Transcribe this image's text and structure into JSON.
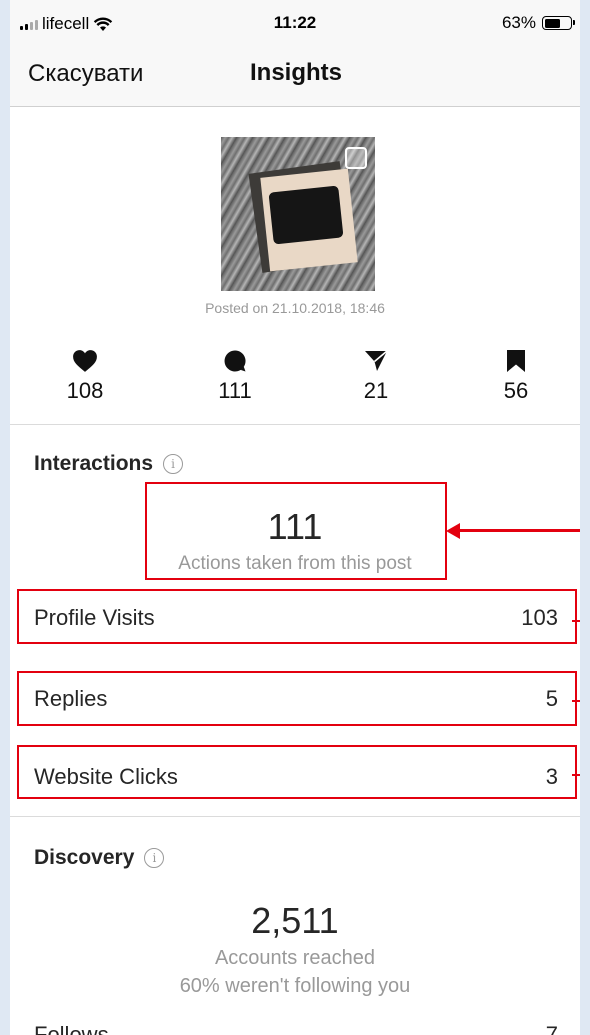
{
  "status_bar": {
    "carrier": "lifecell",
    "time": "11:22",
    "battery": "63%",
    "battery_level": 0.63
  },
  "nav": {
    "cancel_label": "Скасувати",
    "title": "Insights"
  },
  "post": {
    "posted": "Posted on 21.10.2018, 18:46"
  },
  "stats": [
    {
      "icon": "heart-icon",
      "value": "108"
    },
    {
      "icon": "comment-icon",
      "value": "111"
    },
    {
      "icon": "send-icon",
      "value": "21"
    },
    {
      "icon": "bookmark-icon",
      "value": "56"
    }
  ],
  "interactions": {
    "title": "Interactions",
    "total": "111",
    "total_label": "Actions taken from this post",
    "rows": [
      {
        "label": "Profile Visits",
        "value": "103"
      },
      {
        "label": "Replies",
        "value": "5"
      },
      {
        "label": "Website Clicks",
        "value": "3"
      }
    ]
  },
  "discovery": {
    "title": "Discovery",
    "total": "2,511",
    "total_label": "Accounts reached",
    "following_note": "60% weren't following you",
    "rows": [
      {
        "label": "Follows",
        "value": "7"
      }
    ]
  },
  "colors": {
    "annotation": "#e3000f",
    "page_bg": "#dfe8f3"
  }
}
